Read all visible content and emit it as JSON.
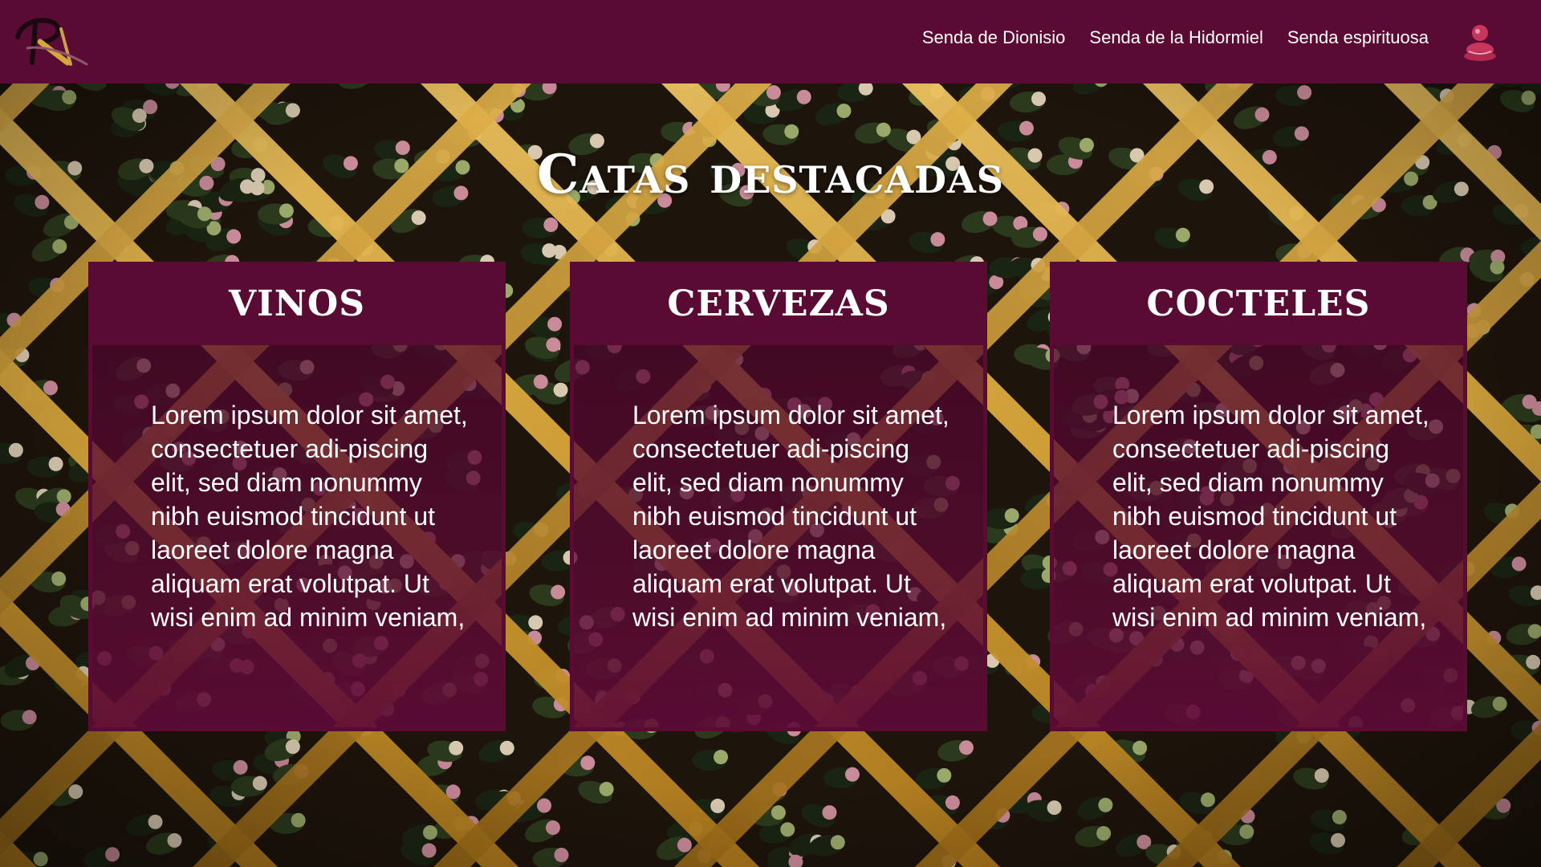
{
  "header": {
    "nav": [
      {
        "label": "Senda de Dionisio"
      },
      {
        "label": "Senda de la Hidormiel"
      },
      {
        "label": "Senda espirituosa"
      }
    ],
    "user_icon": "user-icon",
    "logo_icon": "brand-logo-icon"
  },
  "main": {
    "title": "Catas destacadas",
    "cards": [
      {
        "title": "VINOS",
        "text": "Lorem ipsum dolor sit amet, consectetuer adi-piscing elit, sed diam nonummy nibh euismod tincidunt ut laoreet dolore magna aliquam erat volutpat. Ut wisi enim ad minim veniam,"
      },
      {
        "title": "CERVEZAS",
        "text": "Lorem ipsum dolor sit amet, consectetuer adi-piscing elit, sed diam nonummy nibh euismod tincidunt ut laoreet dolore magna aliquam erat volutpat. Ut wisi enim ad minim veniam,"
      },
      {
        "title": "COCTELES",
        "text": "Lorem ipsum dolor sit amet, consectetuer adi-piscing elit, sed diam nonummy nibh euismod tincidunt ut laoreet dolore magna aliquam erat volutpat. Ut wisi enim ad minim veniam,"
      }
    ]
  },
  "colors": {
    "brand": "#5a0b33",
    "wood": "#d9a63a",
    "text": "#ffffff"
  }
}
